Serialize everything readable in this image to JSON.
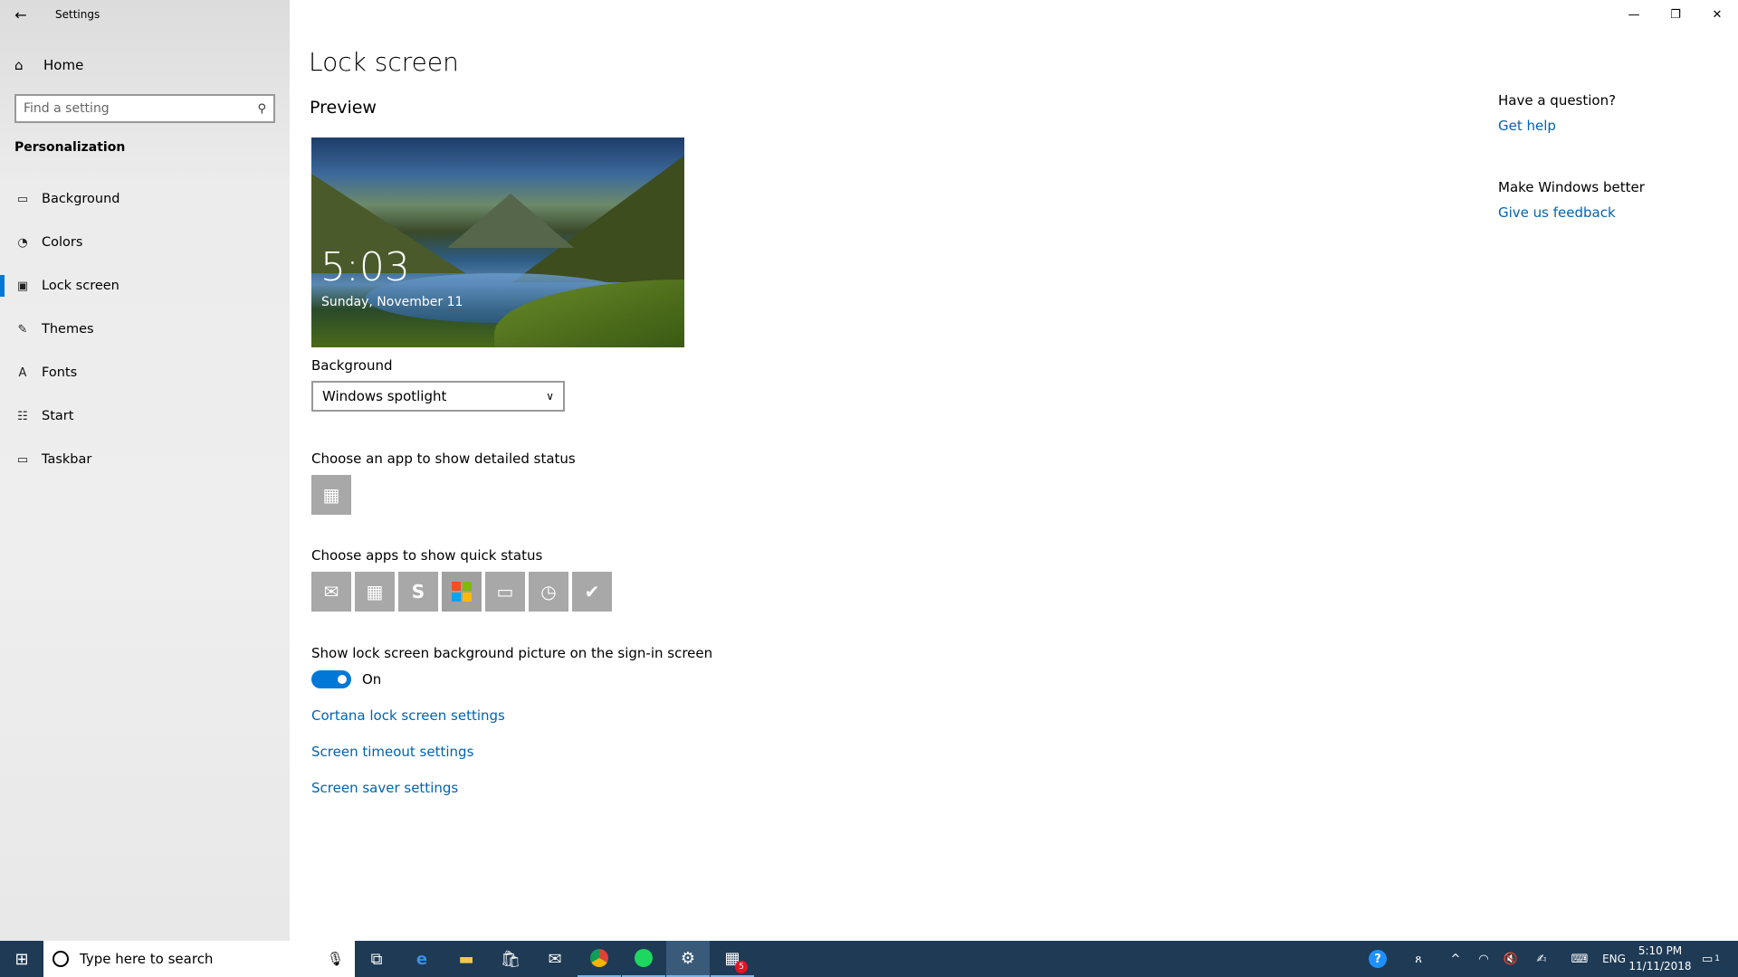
{
  "window": {
    "title": "Settings",
    "back_glyph": "←",
    "controls": {
      "minimize": "—",
      "restore": "❐",
      "close": "✕"
    }
  },
  "sidebar": {
    "home_label": "Home",
    "search_placeholder": "Find a setting",
    "section_title": "Personalization",
    "items": [
      {
        "label": "Background",
        "icon": "picture-icon",
        "glyph": "▭",
        "active": false
      },
      {
        "label": "Colors",
        "icon": "palette-icon",
        "glyph": "◔",
        "active": false
      },
      {
        "label": "Lock screen",
        "icon": "lock-screen-icon",
        "glyph": "▣",
        "active": true
      },
      {
        "label": "Themes",
        "icon": "brush-icon",
        "glyph": "✎",
        "active": false
      },
      {
        "label": "Fonts",
        "icon": "font-icon",
        "glyph": "A",
        "active": false
      },
      {
        "label": "Start",
        "icon": "start-menu-icon",
        "glyph": "☷",
        "active": false
      },
      {
        "label": "Taskbar",
        "icon": "taskbar-icon",
        "glyph": "▭",
        "active": false
      }
    ]
  },
  "main": {
    "page_title": "Lock screen",
    "preview_heading": "Preview",
    "preview_time": "5:03",
    "preview_date": "Sunday, November 11",
    "background_label": "Background",
    "background_value": "Windows spotlight",
    "detailed_status_label": "Choose an app to show detailed status",
    "quick_status_label": "Choose apps to show quick status",
    "quick_status_apps": [
      "mail-icon",
      "calendar-icon",
      "skype-icon",
      "microsoft-store-icon",
      "messaging-icon",
      "alarms-icon",
      "check-icon"
    ],
    "signin_label": "Show lock screen background picture on the sign-in screen",
    "signin_toggle_state": "On",
    "links": [
      "Cortana lock screen settings",
      "Screen timeout settings",
      "Screen saver settings"
    ],
    "colors": {
      "accent": "#0078d7",
      "link": "#0063b1"
    }
  },
  "right": {
    "question_heading": "Have a question?",
    "get_help": "Get help",
    "better_heading": "Make Windows better",
    "feedback": "Give us feedback"
  },
  "taskbar": {
    "search_placeholder": "Type here to search",
    "language": "ENG",
    "time": "5:10 PM",
    "date": "11/11/2018",
    "notification_count": "1",
    "calendar_badge": "5"
  }
}
